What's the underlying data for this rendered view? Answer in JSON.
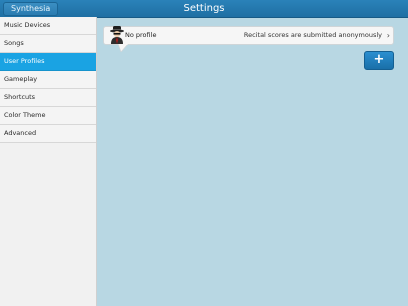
{
  "header": {
    "back_label": "Synthesia",
    "title": "Settings"
  },
  "sidebar": {
    "items": [
      {
        "label": "Music Devices",
        "selected": false
      },
      {
        "label": "Songs",
        "selected": false
      },
      {
        "label": "User Profiles",
        "selected": true
      },
      {
        "label": "Gameplay",
        "selected": false
      },
      {
        "label": "Shortcuts",
        "selected": false
      },
      {
        "label": "Color Theme",
        "selected": false
      },
      {
        "label": "Advanced",
        "selected": false
      }
    ]
  },
  "profile": {
    "name": "No profile",
    "status": "Recital scores are submitted anonymously",
    "avatar_icon": "anonymous-user-icon",
    "chevron_icon": "chevron-right-icon"
  },
  "add_button": {
    "label": "+",
    "icon": "plus-icon"
  },
  "colors": {
    "accent": "#1aa3e3",
    "header": "#2a82b9",
    "content_bg": "#b8d7e3",
    "sidebar_bg": "#f1f1f1",
    "add_button": "#1a6fa8"
  }
}
